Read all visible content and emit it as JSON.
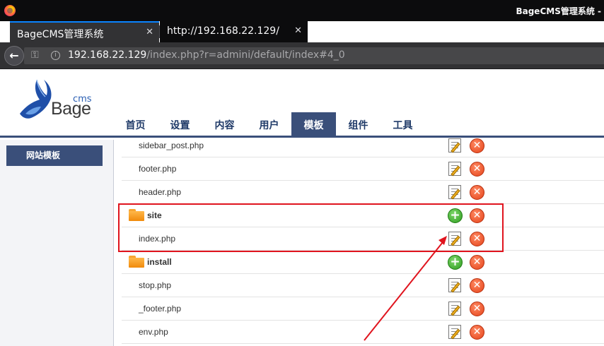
{
  "browser": {
    "window_title": "BageCMS管理系统 -",
    "tabs": [
      {
        "label": "BageCMS管理系统",
        "close": "✕"
      },
      {
        "label": "http://192.168.22.129/",
        "close": "✕"
      }
    ],
    "new_tab": "+",
    "url_host": "192.168.22.129",
    "url_path": "/index.php?r=admini/default/index#4_0"
  },
  "logo": {
    "cms": "cms",
    "name": "Bage"
  },
  "nav": {
    "items": [
      "首页",
      "设置",
      "内容",
      "用户",
      "模板",
      "组件",
      "工具"
    ],
    "active_index": 4
  },
  "sidebar": {
    "button_label": "网站模板"
  },
  "files": [
    {
      "name": "sidebar_post.php",
      "type": "file"
    },
    {
      "name": "footer.php",
      "type": "file"
    },
    {
      "name": "header.php",
      "type": "file"
    },
    {
      "name": "site",
      "type": "folder"
    },
    {
      "name": "index.php",
      "type": "file"
    },
    {
      "name": "install",
      "type": "folder"
    },
    {
      "name": "stop.php",
      "type": "file"
    },
    {
      "name": "_footer.php",
      "type": "file"
    },
    {
      "name": "env.php",
      "type": "file"
    }
  ],
  "icons": {
    "add": "plus-icon",
    "edit": "edit-icon",
    "delete": "delete-icon"
  },
  "colors": {
    "accent": "#3a4f7a",
    "annotation": "#e0141e"
  }
}
